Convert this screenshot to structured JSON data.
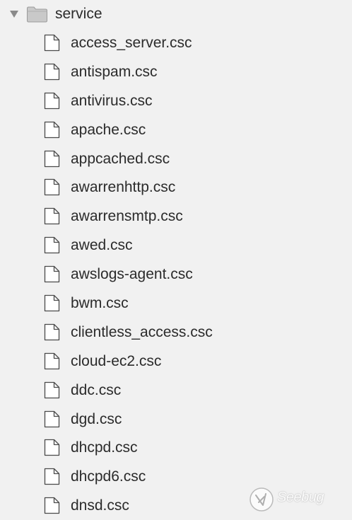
{
  "folder": {
    "name": "service",
    "expanded": true,
    "icon": "folder-icon"
  },
  "files": [
    {
      "name": "access_server.csc",
      "icon": "file-icon"
    },
    {
      "name": "antispam.csc",
      "icon": "file-icon"
    },
    {
      "name": "antivirus.csc",
      "icon": "file-icon"
    },
    {
      "name": "apache.csc",
      "icon": "file-icon"
    },
    {
      "name": "appcached.csc",
      "icon": "file-icon"
    },
    {
      "name": "awarrenhttp.csc",
      "icon": "file-icon"
    },
    {
      "name": "awarrensmtp.csc",
      "icon": "file-icon"
    },
    {
      "name": "awed.csc",
      "icon": "file-icon"
    },
    {
      "name": "awslogs-agent.csc",
      "icon": "file-icon"
    },
    {
      "name": "bwm.csc",
      "icon": "file-icon"
    },
    {
      "name": "clientless_access.csc",
      "icon": "file-icon"
    },
    {
      "name": "cloud-ec2.csc",
      "icon": "file-icon"
    },
    {
      "name": "ddc.csc",
      "icon": "file-icon"
    },
    {
      "name": "dgd.csc",
      "icon": "file-icon"
    },
    {
      "name": "dhcpd.csc",
      "icon": "file-icon"
    },
    {
      "name": "dhcpd6.csc",
      "icon": "file-icon"
    },
    {
      "name": "dnsd.csc",
      "icon": "file-icon"
    }
  ],
  "watermark": {
    "text": "Seebug"
  },
  "colors": {
    "background": "#f1f1f1",
    "text": "#2b2b2b",
    "icon_stroke": "#4a4a4a",
    "folder_fill": "#c9c9c9",
    "disclosure": "#8a8a8a"
  }
}
